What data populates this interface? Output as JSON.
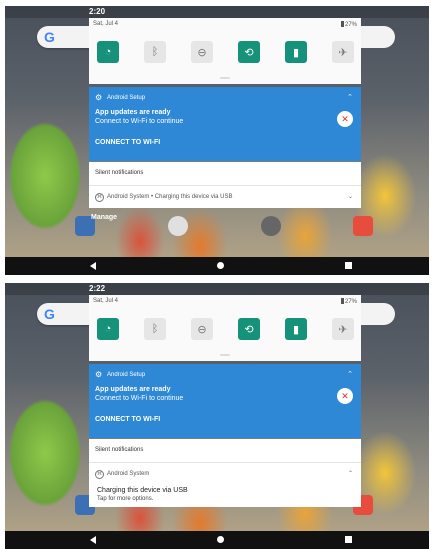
{
  "screen1": {
    "time": "2:20",
    "date": "Sat, Jul 4",
    "battery": "27%",
    "setup_app": "Android Setup",
    "setup_title": "App updates are ready",
    "setup_text": "Connect to Wi-Fi to continue",
    "setup_action": "CONNECT TO WI-FI",
    "silent_header": "Silent notifications",
    "system_row": "Android System • Charging this device via USB",
    "manage": "Manage"
  },
  "screen2": {
    "time": "2:22",
    "date": "Sat, Jul 4",
    "battery": "27%",
    "setup_app": "Android Setup",
    "setup_title": "App updates are ready",
    "setup_text": "Connect to Wi-Fi to continue",
    "setup_action": "CONNECT TO WI-FI",
    "silent_header": "Silent notifications",
    "system_app": "Android System",
    "system_title": "Charging this device via USB",
    "system_text": "Tap for more options."
  },
  "icons": {
    "tiles": [
      "wifi-off-icon",
      "bluetooth-icon",
      "dnd-icon",
      "auto-rotate-icon",
      "battery-saver-icon",
      "airplane-icon"
    ],
    "accent": "#17927a",
    "card_blue": "#2e88d6"
  }
}
